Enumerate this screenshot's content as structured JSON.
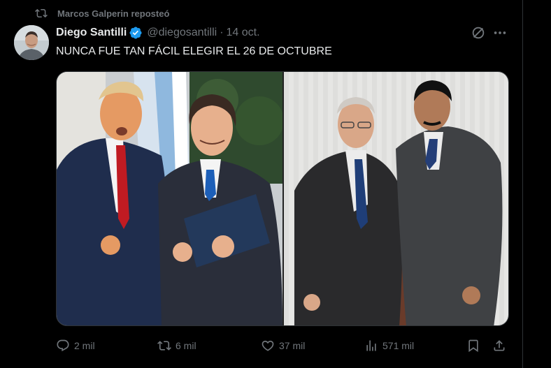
{
  "repost": {
    "icon": "repost-icon",
    "text": "Marcos Galperin reposteó"
  },
  "tweet": {
    "author_name": "Diego Santilli",
    "handle": "@diegosantilli",
    "separator": "·",
    "date": "14 oct.",
    "text": "NUNCA FUE TAN FÁCIL ELEGIR EL 26 DE OCTUBRE",
    "verified_color": "#1d9bf0"
  },
  "actions": {
    "replies": "2 mil",
    "reposts": "6 mil",
    "likes": "37 mil",
    "views": "571 mil"
  },
  "colors": {
    "background": "#000000",
    "text": "#e7e9ea",
    "muted": "#71767b",
    "border": "#2f3336"
  }
}
